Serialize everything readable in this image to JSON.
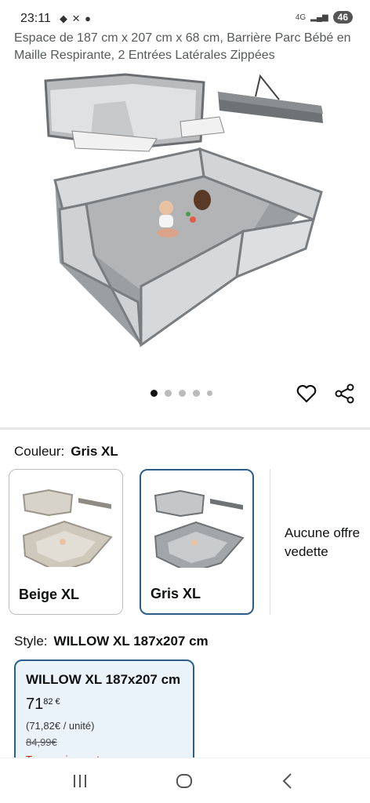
{
  "status": {
    "time": "23:11",
    "network": "4G",
    "battery": "46"
  },
  "product": {
    "title": "Espace de 187 cm x 207 cm x 68 cm, Barrière Parc Bébé en Maille Respirante, 2 Entrées Latérales Zippées"
  },
  "gallery": {
    "image_count": 5,
    "active_index": 0
  },
  "color": {
    "label": "Couleur:",
    "selected": "Gris XL",
    "options": [
      {
        "name": "Beige XL",
        "tone": "#cfc8bd"
      },
      {
        "name": "Gris XL",
        "tone": "#9a9c9e"
      }
    ],
    "no_offer": "Aucune offre vedette"
  },
  "style": {
    "label": "Style:",
    "selected": "WILLOW XL 187x207 cm",
    "card": {
      "name": "WILLOW XL 187x207 cm",
      "price_whole": "71",
      "price_cents": "82 €",
      "unit_price": "(71,82€ / unité)",
      "old_price": "84,99€",
      "promo": "Temporairement en..."
    }
  },
  "colors": {
    "accent": "#2b5f8a",
    "promo": "#b12704"
  }
}
